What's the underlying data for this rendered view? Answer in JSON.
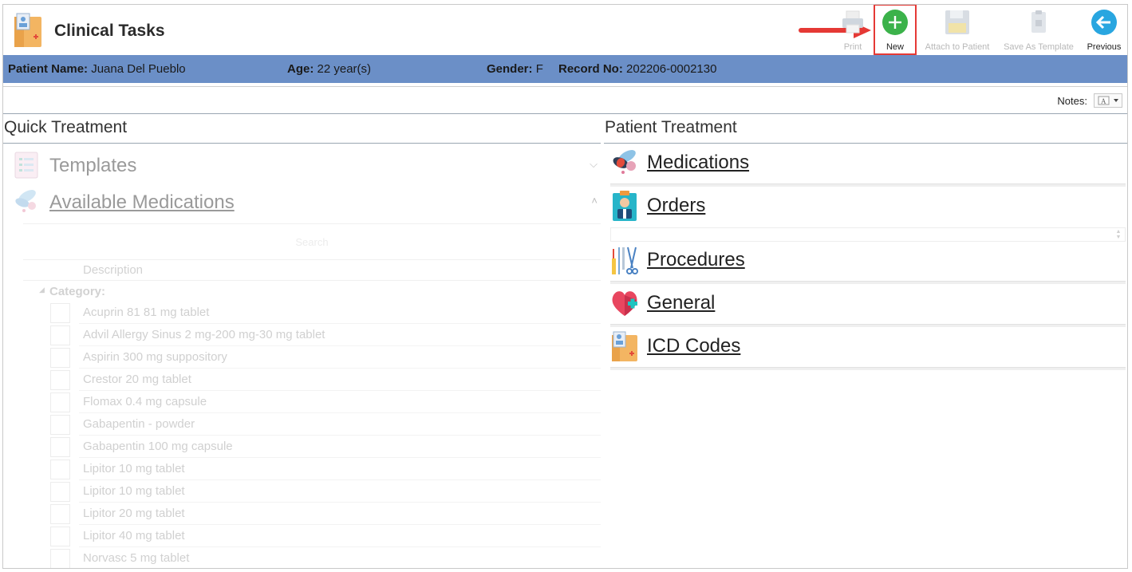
{
  "header": {
    "title": "Clinical Tasks",
    "toolbar": [
      {
        "id": "print",
        "label": "Print",
        "icon": "printer-icon",
        "enabled": false
      },
      {
        "id": "new",
        "label": "New",
        "icon": "plus-circle-icon",
        "enabled": true
      },
      {
        "id": "attach",
        "label": "Attach to Patient",
        "icon": "save-disk-icon",
        "enabled": false
      },
      {
        "id": "save-template",
        "label": "Save As Template",
        "icon": "clipboard-icon",
        "enabled": false
      },
      {
        "id": "previous",
        "label": "Previous",
        "icon": "arrow-left-circle-icon",
        "enabled": true
      }
    ]
  },
  "patient": {
    "name_label": "Patient Name:",
    "name": "Juana Del Pueblo",
    "age_label": "Age:",
    "age": "22 year(s)",
    "gender_label": "Gender:",
    "gender": "F",
    "record_label": "Record No:",
    "record": "202206-0002130"
  },
  "notes": {
    "label": "Notes:"
  },
  "quick_treatment": {
    "title": "Quick Treatment",
    "templates_label": "Templates",
    "available_label": "Available Medications",
    "search_placeholder": "Search",
    "column_description": "Description",
    "category_label": "Category:",
    "medications": [
      "Acuprin 81 81 mg tablet",
      "Advil Allergy Sinus 2 mg-200 mg-30 mg tablet",
      "Aspirin 300 mg suppository",
      "Crestor 20 mg tablet",
      "Flomax 0.4 mg capsule",
      "Gabapentin - powder",
      "Gabapentin 100 mg capsule",
      "Lipitor 10 mg tablet",
      "Lipitor 10 mg tablet",
      "Lipitor 20 mg tablet",
      "Lipitor 40 mg tablet",
      "Norvasc 5 mg tablet"
    ]
  },
  "patient_treatment": {
    "title": "Patient Treatment",
    "sections": [
      {
        "label": "Medications",
        "icon": "pills-icon"
      },
      {
        "label": "Orders",
        "icon": "clipboard-doctor-icon"
      },
      {
        "label": "Procedures",
        "icon": "surgical-tools-icon"
      },
      {
        "label": "General",
        "icon": "heart-plus-icon"
      },
      {
        "label": "ICD Codes",
        "icon": "medical-folder-icon"
      }
    ]
  },
  "colors": {
    "patient_bar": "#6b8fc7",
    "new_button": "#3bb24a",
    "previous_button": "#29a6e0",
    "highlight": "#e53935"
  }
}
